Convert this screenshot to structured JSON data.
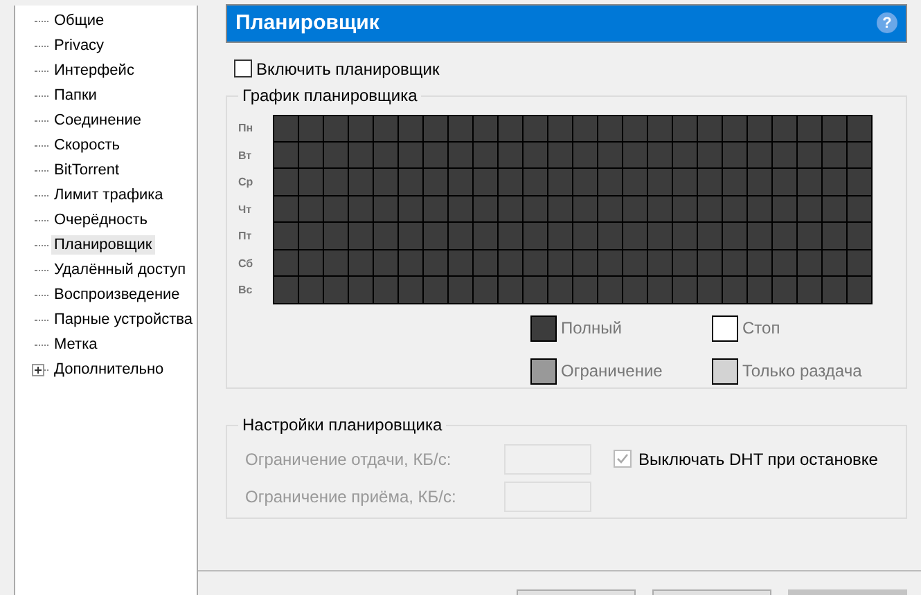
{
  "sidebar": {
    "items": [
      {
        "label": "Общие",
        "selected": false
      },
      {
        "label": "Privacy",
        "selected": false
      },
      {
        "label": "Интерфейс",
        "selected": false
      },
      {
        "label": "Папки",
        "selected": false
      },
      {
        "label": "Соединение",
        "selected": false
      },
      {
        "label": "Скорость",
        "selected": false
      },
      {
        "label": "BitTorrent",
        "selected": false
      },
      {
        "label": "Лимит трафика",
        "selected": false
      },
      {
        "label": "Очерёдность",
        "selected": false
      },
      {
        "label": "Планировщик",
        "selected": true
      },
      {
        "label": "Удалённый доступ",
        "selected": false
      },
      {
        "label": "Воспроизведение",
        "selected": false
      },
      {
        "label": "Парные устройства",
        "selected": false
      },
      {
        "label": "Метка",
        "selected": false
      },
      {
        "label": "Дополнительно",
        "selected": false,
        "expanded": false
      }
    ]
  },
  "header": {
    "title": "Планировщик",
    "help": "?"
  },
  "enable_checkbox": {
    "label": "Включить планировщик",
    "checked": false
  },
  "schedule": {
    "title": "График планировщика",
    "days": [
      {
        "label": "Пн",
        "cells": [
          {
            "kind": "full"
          },
          {
            "kind": "full"
          },
          {
            "kind": "full"
          },
          {
            "kind": "full"
          },
          {
            "kind": "full"
          },
          {
            "kind": "full"
          },
          {
            "kind": "full"
          },
          {
            "kind": "full"
          },
          {
            "kind": "full"
          },
          {
            "kind": "full"
          },
          {
            "kind": "full"
          },
          {
            "kind": "full"
          },
          {
            "kind": "full"
          },
          {
            "kind": "full"
          },
          {
            "kind": "full"
          },
          {
            "kind": "full"
          },
          {
            "kind": "full"
          },
          {
            "kind": "full"
          },
          {
            "kind": "full"
          },
          {
            "kind": "full"
          },
          {
            "kind": "full"
          },
          {
            "kind": "full"
          },
          {
            "kind": "full"
          },
          {
            "kind": "full"
          }
        ]
      },
      {
        "label": "Вт",
        "cells": [
          {
            "kind": "full"
          },
          {
            "kind": "full"
          },
          {
            "kind": "full"
          },
          {
            "kind": "full"
          },
          {
            "kind": "full"
          },
          {
            "kind": "full"
          },
          {
            "kind": "full"
          },
          {
            "kind": "full"
          },
          {
            "kind": "full"
          },
          {
            "kind": "full"
          },
          {
            "kind": "full"
          },
          {
            "kind": "full"
          },
          {
            "kind": "full"
          },
          {
            "kind": "full"
          },
          {
            "kind": "full"
          },
          {
            "kind": "full"
          },
          {
            "kind": "full"
          },
          {
            "kind": "full"
          },
          {
            "kind": "full"
          },
          {
            "kind": "full"
          },
          {
            "kind": "full"
          },
          {
            "kind": "full"
          },
          {
            "kind": "full"
          },
          {
            "kind": "full"
          }
        ]
      },
      {
        "label": "Ср",
        "cells": [
          {
            "kind": "full"
          },
          {
            "kind": "full"
          },
          {
            "kind": "full"
          },
          {
            "kind": "full"
          },
          {
            "kind": "full"
          },
          {
            "kind": "full"
          },
          {
            "kind": "full"
          },
          {
            "kind": "full"
          },
          {
            "kind": "full"
          },
          {
            "kind": "full"
          },
          {
            "kind": "full"
          },
          {
            "kind": "full"
          },
          {
            "kind": "full"
          },
          {
            "kind": "full"
          },
          {
            "kind": "full"
          },
          {
            "kind": "full"
          },
          {
            "kind": "full"
          },
          {
            "kind": "full"
          },
          {
            "kind": "full"
          },
          {
            "kind": "full"
          },
          {
            "kind": "full"
          },
          {
            "kind": "full"
          },
          {
            "kind": "full"
          },
          {
            "kind": "full"
          }
        ]
      },
      {
        "label": "Чт",
        "cells": [
          {
            "kind": "full"
          },
          {
            "kind": "full"
          },
          {
            "kind": "full"
          },
          {
            "kind": "full"
          },
          {
            "kind": "full"
          },
          {
            "kind": "full"
          },
          {
            "kind": "full"
          },
          {
            "kind": "full"
          },
          {
            "kind": "full"
          },
          {
            "kind": "full"
          },
          {
            "kind": "full"
          },
          {
            "kind": "full"
          },
          {
            "kind": "full"
          },
          {
            "kind": "full"
          },
          {
            "kind": "full"
          },
          {
            "kind": "full"
          },
          {
            "kind": "full"
          },
          {
            "kind": "full"
          },
          {
            "kind": "full"
          },
          {
            "kind": "full"
          },
          {
            "kind": "full"
          },
          {
            "kind": "full"
          },
          {
            "kind": "full"
          },
          {
            "kind": "full"
          }
        ]
      },
      {
        "label": "Пт",
        "cells": [
          {
            "kind": "full"
          },
          {
            "kind": "full"
          },
          {
            "kind": "full"
          },
          {
            "kind": "full"
          },
          {
            "kind": "full"
          },
          {
            "kind": "full"
          },
          {
            "kind": "full"
          },
          {
            "kind": "full"
          },
          {
            "kind": "full"
          },
          {
            "kind": "full"
          },
          {
            "kind": "full"
          },
          {
            "kind": "full"
          },
          {
            "kind": "full"
          },
          {
            "kind": "full"
          },
          {
            "kind": "full"
          },
          {
            "kind": "full"
          },
          {
            "kind": "full"
          },
          {
            "kind": "full"
          },
          {
            "kind": "full"
          },
          {
            "kind": "full"
          },
          {
            "kind": "full"
          },
          {
            "kind": "full"
          },
          {
            "kind": "full"
          },
          {
            "kind": "full"
          }
        ]
      },
      {
        "label": "Сб",
        "cells": [
          {
            "kind": "full"
          },
          {
            "kind": "full"
          },
          {
            "kind": "full"
          },
          {
            "kind": "full"
          },
          {
            "kind": "full"
          },
          {
            "kind": "full"
          },
          {
            "kind": "full"
          },
          {
            "kind": "full"
          },
          {
            "kind": "full"
          },
          {
            "kind": "full"
          },
          {
            "kind": "full"
          },
          {
            "kind": "full"
          },
          {
            "kind": "full"
          },
          {
            "kind": "full"
          },
          {
            "kind": "full"
          },
          {
            "kind": "full"
          },
          {
            "kind": "full"
          },
          {
            "kind": "full"
          },
          {
            "kind": "full"
          },
          {
            "kind": "full"
          },
          {
            "kind": "full"
          },
          {
            "kind": "full"
          },
          {
            "kind": "full"
          },
          {
            "kind": "full"
          }
        ]
      },
      {
        "label": "Вс",
        "cells": [
          {
            "kind": "full"
          },
          {
            "kind": "full"
          },
          {
            "kind": "full"
          },
          {
            "kind": "full"
          },
          {
            "kind": "full"
          },
          {
            "kind": "full"
          },
          {
            "kind": "full"
          },
          {
            "kind": "full"
          },
          {
            "kind": "full"
          },
          {
            "kind": "full"
          },
          {
            "kind": "full"
          },
          {
            "kind": "full"
          },
          {
            "kind": "full"
          },
          {
            "kind": "full"
          },
          {
            "kind": "full"
          },
          {
            "kind": "full"
          },
          {
            "kind": "full"
          },
          {
            "kind": "full"
          },
          {
            "kind": "full"
          },
          {
            "kind": "full"
          },
          {
            "kind": "full"
          },
          {
            "kind": "full"
          },
          {
            "kind": "full"
          },
          {
            "kind": "full"
          }
        ]
      }
    ],
    "legend": [
      {
        "kind": "full",
        "label": "Полный"
      },
      {
        "kind": "stop",
        "label": "Стоп"
      },
      {
        "kind": "limit",
        "label": "Ограничение"
      },
      {
        "kind": "seed",
        "label": "Только раздача"
      }
    ]
  },
  "settings": {
    "title": "Настройки планировщика",
    "fields": [
      {
        "label": "Ограничение отдачи, КБ/с:",
        "disabled": true
      },
      {
        "label": "Ограничение приёма, КБ/с:",
        "disabled": true
      }
    ],
    "dht_checkbox": {
      "label": "Выключать DHT при остановке",
      "checked": true,
      "disabled": true
    }
  },
  "buttons": [
    {
      "disabled": false
    },
    {
      "disabled": false
    },
    {
      "disabled": true
    }
  ]
}
